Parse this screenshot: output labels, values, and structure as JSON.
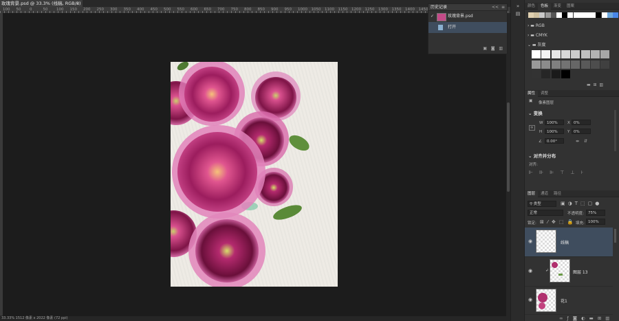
{
  "document": {
    "tab_title": "玫瑰背景.psd @ 33.3% (线稿, RGB/8)",
    "close": "×",
    "ruler_labels": [
      "100",
      "50",
      "0",
      "50",
      "100",
      "150",
      "200",
      "250",
      "300",
      "350",
      "400",
      "450",
      "500",
      "550",
      "600",
      "650",
      "700",
      "750",
      "800",
      "850",
      "900",
      "950",
      "1000",
      "1050",
      "1100",
      "1150",
      "1200",
      "1250",
      "1300",
      "1350",
      "1400",
      "1450",
      "150"
    ],
    "status": "33.33%    1512 像素 x 2022 像素 (72 ppi)"
  },
  "history": {
    "tab": "历史记录",
    "collapse": "<<",
    "menu": "≡",
    "items": [
      {
        "label": "玫瑰背景.psd"
      },
      {
        "label": "打开"
      }
    ]
  },
  "swatches": {
    "tabs": [
      "颜色",
      "色板",
      "渐变",
      "图案"
    ],
    "active_tab": "色板",
    "top_colors": [
      "#e0d0b0",
      "#cfc0a0",
      "#c8c8c8",
      "#999999",
      "#555555",
      "#ffffff",
      "#000000",
      "#ffffff",
      "#ffffff",
      "#ffffff",
      "#ffffff",
      "#ffffff",
      "#000000",
      "#ffffff",
      "#6fa8dc",
      "#4a86e8"
    ],
    "folders": [
      "RGB",
      "CMYK",
      "灰度"
    ],
    "grays": [
      "#ffffff",
      "#f2f2f2",
      "#e6e6e6",
      "#d9d9d9",
      "#cccccc",
      "#bfbfbf",
      "#b3b3b3",
      "#a6a6a6",
      "#999999",
      "#8c8c8c",
      "#808080",
      "#737373",
      "#666666",
      "#595959",
      "#4d4d4d",
      "#404040",
      "#333333",
      "#262626",
      "#1a1a1a",
      "#000000"
    ]
  },
  "properties": {
    "tabs": [
      "属性",
      "调整"
    ],
    "active_tab": "属性",
    "kind": "像素图层",
    "transform_title": "变换",
    "w_label": "W",
    "w_value": "100%",
    "x_label": "X",
    "x_value": "0%",
    "h_label": "H",
    "h_value": "100%",
    "y_label": "Y",
    "y_value": "0%",
    "angle_value": "0.00°",
    "align_title": "对齐并分布",
    "align_label": "对齐:"
  },
  "layers": {
    "tabs": [
      "图层",
      "通道",
      "路径"
    ],
    "active_tab": "图层",
    "filter_kind": "类型",
    "blend_mode": "正常",
    "opacity_label": "不透明度:",
    "opacity_value": "75%",
    "lock_label": "锁定:",
    "fill_label": "填充:",
    "fill_value": "100%",
    "items": [
      {
        "name": "线稿",
        "selected": true
      },
      {
        "name": "图层 13",
        "selected": false
      },
      {
        "name": "花1",
        "selected": false
      }
    ]
  }
}
